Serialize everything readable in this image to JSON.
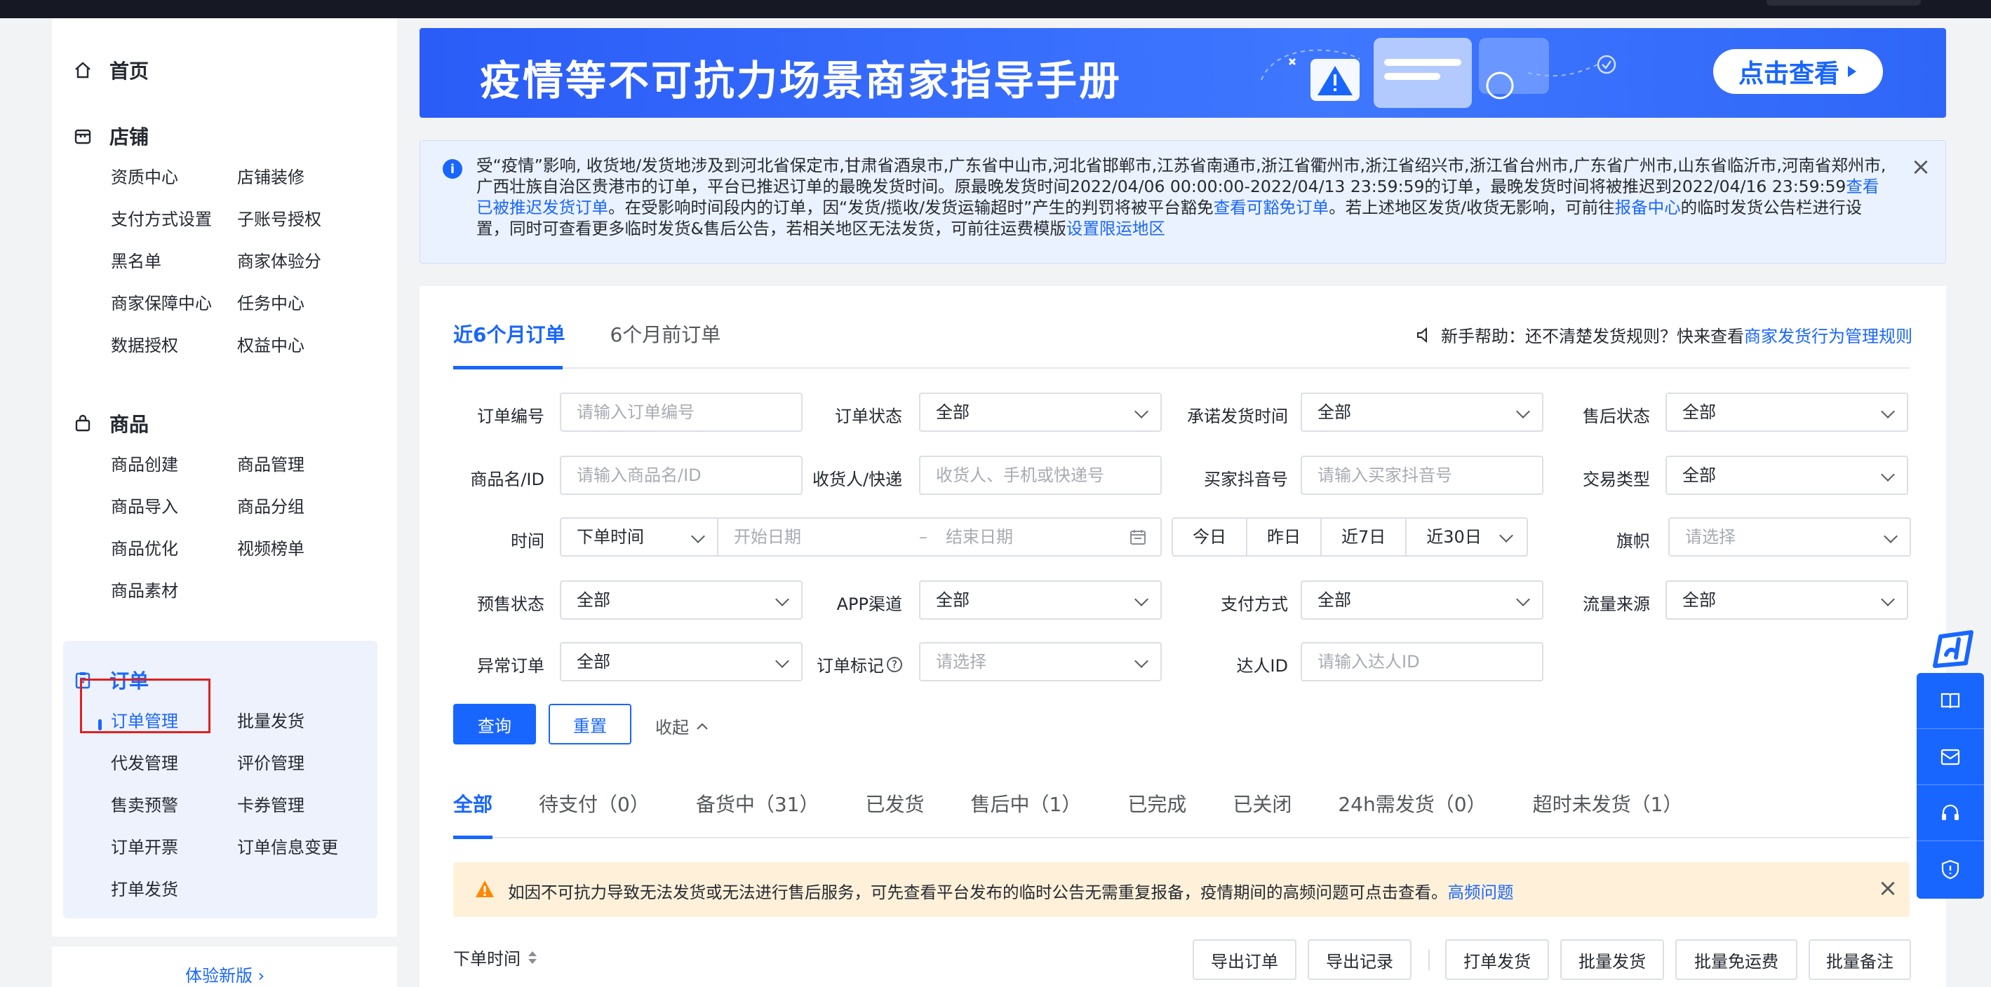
{
  "sidebar": {
    "home": "首页",
    "store": {
      "title": "店铺",
      "items": [
        "资质中心",
        "店铺装修",
        "支付方式设置",
        "子账号授权",
        "黑名单",
        "商家体验分",
        "商家保障中心",
        "任务中心",
        "数据授权",
        "权益中心"
      ]
    },
    "goods": {
      "title": "商品",
      "items": [
        "商品创建",
        "商品管理",
        "商品导入",
        "商品分组",
        "商品优化",
        "视频榜单",
        "商品素材"
      ]
    },
    "order": {
      "title": "订单",
      "items": [
        "订单管理",
        "批量发货",
        "代发管理",
        "评价管理",
        "售卖预警",
        "卡券管理",
        "订单开票",
        "订单信息变更",
        "打单发货"
      ]
    },
    "footer": "体验新版"
  },
  "banner": {
    "title": "疫情等不可抗力场景商家指导手册",
    "cta": "点击查看"
  },
  "notice": {
    "p1": "受“疫情”影响, 收货地/发货地涉及到河北省保定市,甘肃省酒泉市,广东省中山市,河北省邯郸市,江苏省南通市,浙江省衢州市,浙江省绍兴市,浙江省台州市,广东省广州市,山东省临沂市,河南省郑州市,广西壮族自治区贵港市的订单，平台已推迟订单的最晚发货时间。原最晚发货时间2022/04/06 00:00:00-2022/04/13 23:59:59的订单，最晚发货时间将被推迟到2022/04/16 23:59:59",
    "link1": "查看已被推迟发货订单",
    "p2": "。在受影响时间段内的订单，因“发货/揽收/发货运输超时”产生的判罚将被平台豁免",
    "link2": "查看可豁免订单",
    "p3": "。若上述地区发货/收货无影响，可前往",
    "link3": "报备中心",
    "p4": "的临时发货公告栏进行设置，同时可查看更多临时发货&售后公告，若相关地区无法发货，可前往运费模版",
    "link4": "设置限运地区"
  },
  "tabs": {
    "recent": "近6个月订单",
    "older": "6个月前订单"
  },
  "help": {
    "prefix": "新手帮助：还不清楚发货规则？快来查看",
    "link": "商家发货行为管理规则"
  },
  "filters": {
    "order_no": {
      "label": "订单编号",
      "placeholder": "请输入订单编号"
    },
    "order_status": {
      "label": "订单状态",
      "value": "全部"
    },
    "promise_time": {
      "label": "承诺发货时间",
      "value": "全部"
    },
    "after_sale": {
      "label": "售后状态",
      "value": "全部"
    },
    "goods": {
      "label": "商品名/ID",
      "placeholder": "请输入商品名/ID"
    },
    "receiver": {
      "label": "收货人/快递",
      "placeholder": "收货人、手机或快递号"
    },
    "buyer": {
      "label": "买家抖音号",
      "placeholder": "请输入买家抖音号"
    },
    "trade_type": {
      "label": "交易类型",
      "value": "全部"
    },
    "time": {
      "label": "时间",
      "type": "下单时间",
      "start": "开始日期",
      "sep": "–",
      "end": "结束日期"
    },
    "quick": [
      "今日",
      "昨日",
      "近7日",
      "近30日"
    ],
    "flag": {
      "label": "旗帜",
      "placeholder": "请选择"
    },
    "presale": {
      "label": "预售状态",
      "value": "全部"
    },
    "app": {
      "label": "APP渠道",
      "value": "全部"
    },
    "pay": {
      "label": "支付方式",
      "value": "全部"
    },
    "traffic": {
      "label": "流量来源",
      "value": "全部"
    },
    "abnormal": {
      "label": "异常订单",
      "value": "全部"
    },
    "mark": {
      "label": "订单标记",
      "placeholder": "请选择"
    },
    "talent": {
      "label": "达人ID",
      "placeholder": "请输入达人ID"
    }
  },
  "actions": {
    "query": "查询",
    "reset": "重置",
    "collapse": "收起"
  },
  "status_tabs": [
    "全部",
    "待支付（0）",
    "备货中（31）",
    "已发货",
    "售后中（1）",
    "已完成",
    "已关闭",
    "24h需发货（0）",
    "超时未发货（1）"
  ],
  "warn": {
    "text": "如因不可抗力导致无法发货或无法进行售后服务，可先查看平台发布的临时公告无需重复报备，疫情期间的高频问题可点击查看。",
    "link": "高频问题"
  },
  "list": {
    "sort_label": "下单时间",
    "buttons": [
      "导出订单",
      "导出记录",
      "打单发货",
      "批量发货",
      "批量免运费",
      "批量备注"
    ]
  }
}
